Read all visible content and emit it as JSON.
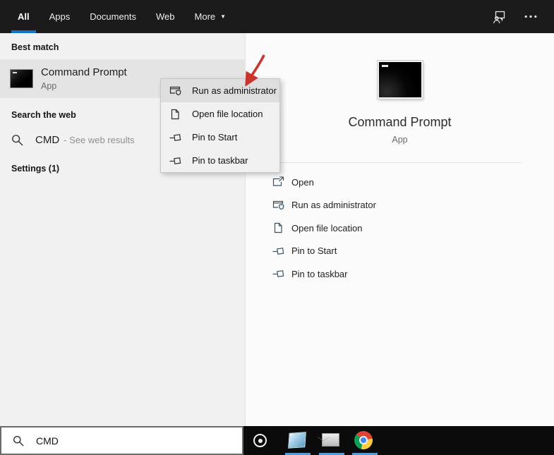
{
  "topbar": {
    "tabs": [
      {
        "label": "All",
        "active": true
      },
      {
        "label": "Apps",
        "active": false
      },
      {
        "label": "Documents",
        "active": false
      },
      {
        "label": "Web",
        "active": false
      },
      {
        "label": "More",
        "active": false,
        "has_dropdown": true
      }
    ],
    "icons": [
      "feedback-icon",
      "ellipsis-icon"
    ]
  },
  "left_panel": {
    "best_match": {
      "header": "Best match",
      "item": {
        "title": "Command Prompt",
        "subtitle": "App",
        "icon": "command-prompt-icon"
      }
    },
    "search_web": {
      "header": "Search the web",
      "item": {
        "query": "CMD",
        "suffix": "- See web results",
        "icon": "search-icon"
      }
    },
    "settings": {
      "header": "Settings (1)"
    }
  },
  "context_menu": {
    "items": [
      {
        "label": "Run as administrator",
        "icon": "run-as-admin-icon",
        "highlighted": true
      },
      {
        "label": "Open file location",
        "icon": "open-file-location-icon",
        "highlighted": false
      },
      {
        "label": "Pin to Start",
        "icon": "pin-icon",
        "highlighted": false
      },
      {
        "label": "Pin to taskbar",
        "icon": "pin-icon",
        "highlighted": false
      }
    ]
  },
  "preview_panel": {
    "app_title": "Command Prompt",
    "app_subtitle": "App",
    "app_icon": "command-prompt-icon",
    "actions": [
      {
        "label": "Open",
        "icon": "open-icon"
      },
      {
        "label": "Run as administrator",
        "icon": "run-as-admin-icon"
      },
      {
        "label": "Open file location",
        "icon": "open-file-location-icon"
      },
      {
        "label": "Pin to Start",
        "icon": "pin-icon"
      },
      {
        "label": "Pin to taskbar",
        "icon": "pin-icon"
      }
    ]
  },
  "search_box": {
    "value": "CMD",
    "icon": "search-icon"
  },
  "taskbar": {
    "icons": [
      "cortana-icon",
      "file-explorer-icon",
      "mail-icon",
      "chrome-icon"
    ]
  },
  "annotation": {
    "type": "red-arrow",
    "points_to": "Run as administrator",
    "color": "#c9342e"
  },
  "colors": {
    "accent_blue": "#1673c5",
    "topbar_bg": "#1b1b1b",
    "left_panel_bg": "#f1f1f1",
    "highlight_row": "#e4e4e4",
    "action_icon": "#3b5266",
    "taskbar_indicator": "#4f9cd6"
  }
}
